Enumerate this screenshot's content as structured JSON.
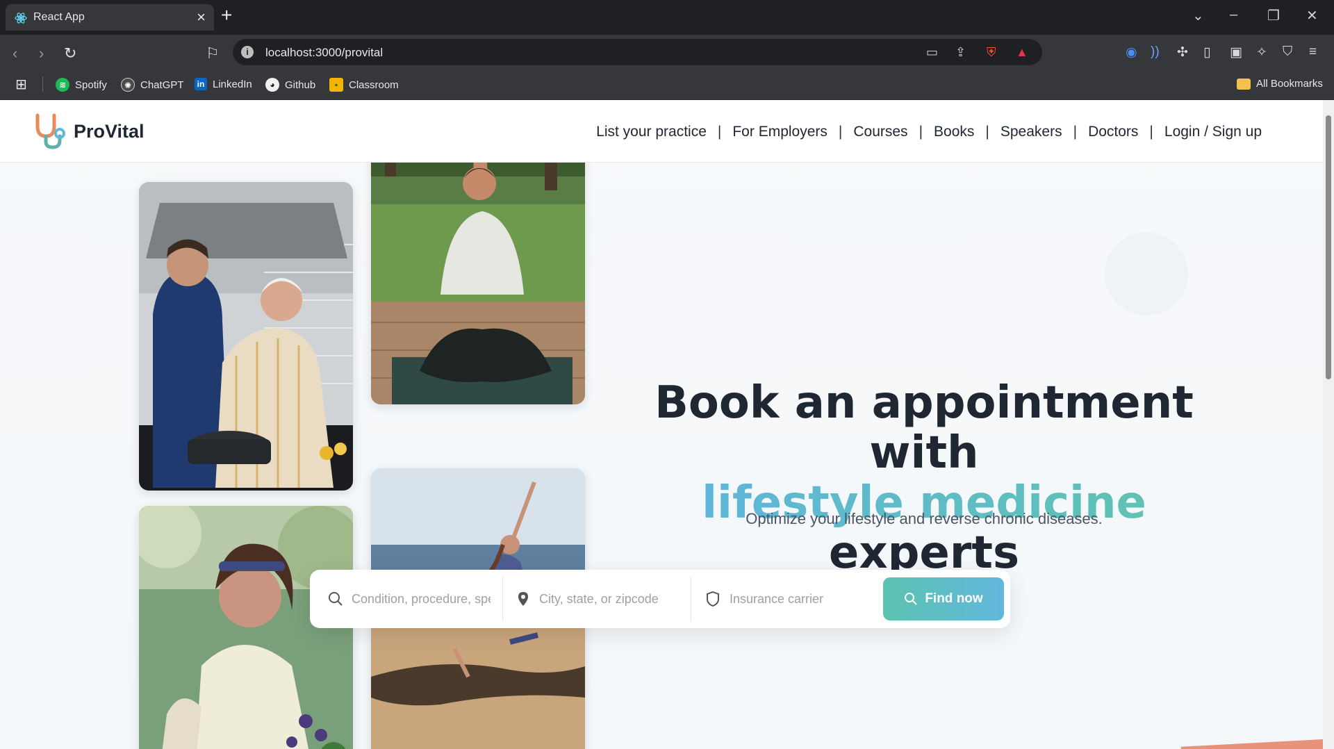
{
  "browser": {
    "tab_title": "React App",
    "url": "localhost:3000/provital",
    "bookmarks": [
      {
        "label": "Spotify",
        "icon": "spotify-icon",
        "color": "#1db954"
      },
      {
        "label": "ChatGPT",
        "icon": "chatgpt-icon",
        "color": "#d0d0d0"
      },
      {
        "label": "LinkedIn",
        "icon": "linkedin-icon",
        "color": "#0a66c2"
      },
      {
        "label": "Github",
        "icon": "github-icon",
        "color": "#ffffff"
      },
      {
        "label": "Classroom",
        "icon": "classroom-icon",
        "color": "#f4b400"
      }
    ],
    "all_bookmarks": "All Bookmarks"
  },
  "site": {
    "brand": "ProVital",
    "nav": [
      "List your practice",
      "For Employers",
      "Courses",
      "Books",
      "Speakers",
      "Doctors",
      "Login / Sign up"
    ],
    "nav_separator": "|",
    "headline_line1": "Book an appointment with",
    "headline_accent": "lifestyle medicine",
    "headline_end": " experts",
    "subtitle": "Optimize your lifestyle and reverse chronic diseases.",
    "search": {
      "condition_placeholder": "Condition, procedure, speciality...",
      "location_placeholder": "City, state, or zipcode",
      "insurance_placeholder": "Insurance carrier",
      "button": "Find now"
    },
    "colors": {
      "accent_start": "#5fb6d9",
      "accent_end": "#5fc2b3",
      "text": "#1e2732"
    }
  }
}
